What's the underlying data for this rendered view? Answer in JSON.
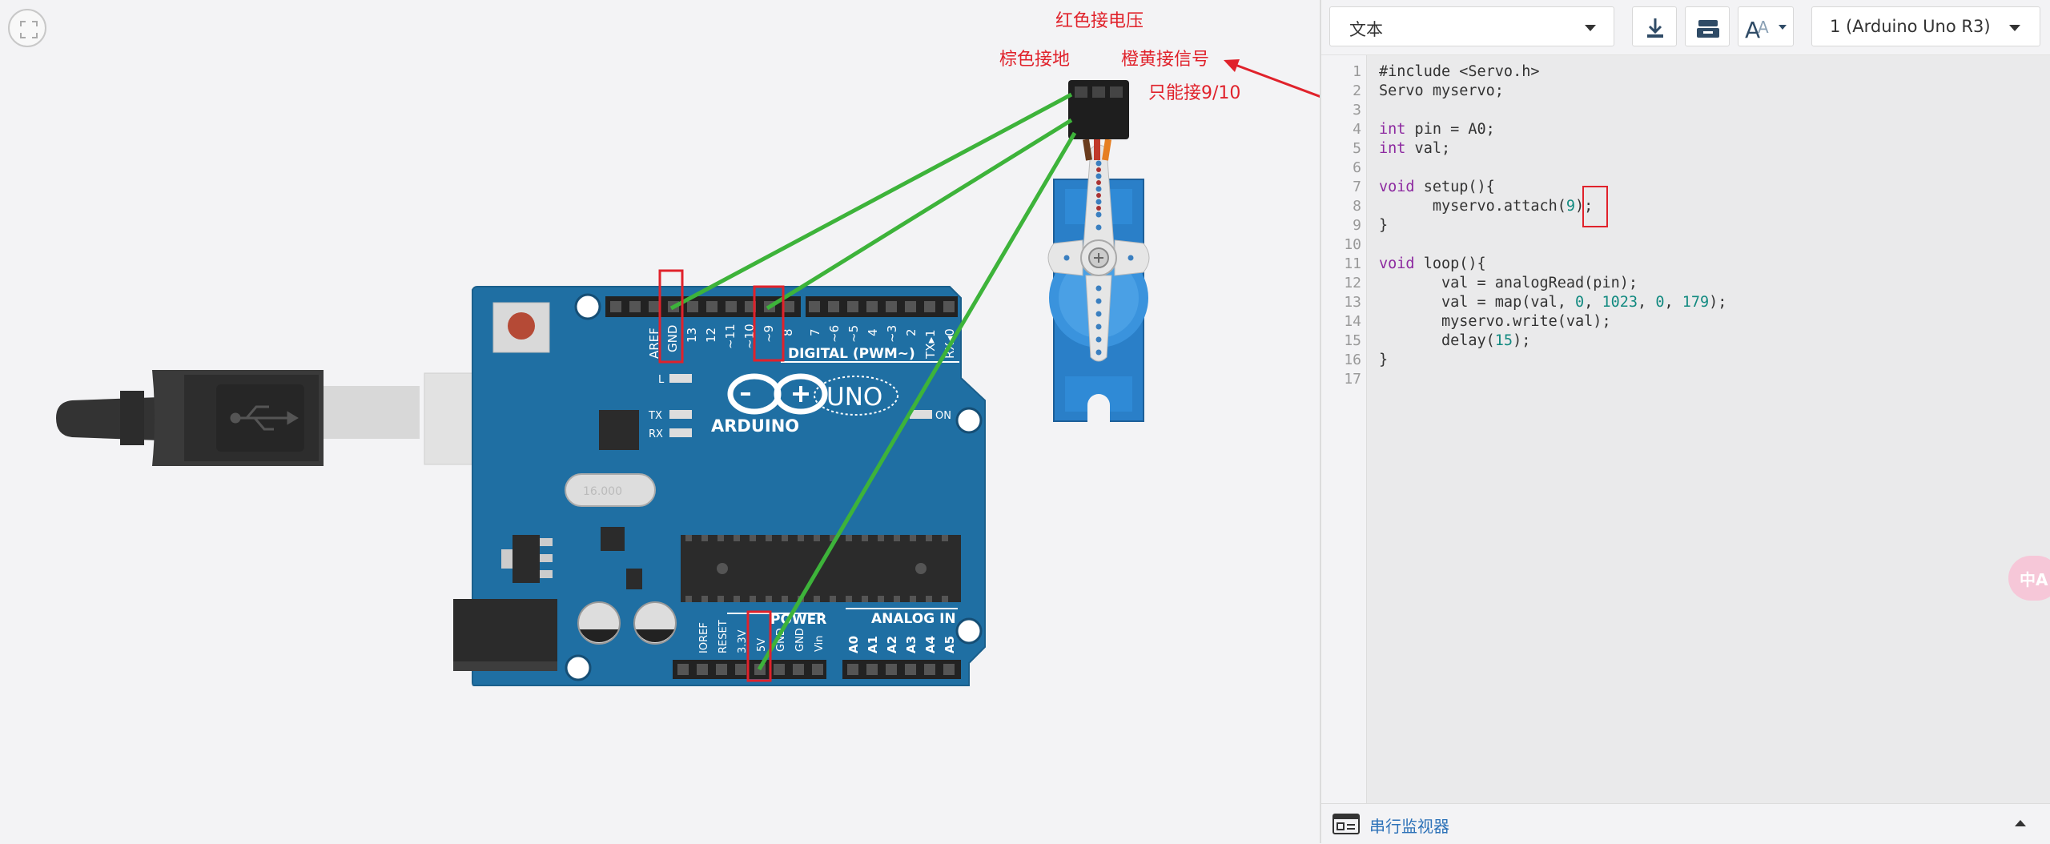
{
  "annotations": {
    "red_voltage": "红色接电压",
    "brown_ground": "棕色接地",
    "orange_signal": "橙黄接信号",
    "only_pins": "只能接9/10"
  },
  "board": {
    "brand": "ARDUINO",
    "model": "UNO",
    "digital_label": "DIGITAL (PWM~)",
    "power_label": "POWER",
    "analog_label": "ANALOG IN",
    "on_label": "ON",
    "led_labels": [
      "L",
      "TX",
      "RX"
    ],
    "top_pin_labels": [
      "AREF",
      "GND",
      "13",
      "12",
      "~11",
      "~10",
      "~9",
      "8",
      "7",
      "~6",
      "~5",
      "4",
      "~3",
      "2",
      "TX▸1",
      "RX◂0"
    ],
    "power_pin_labels": [
      "IOREF",
      "RESET",
      "3.3V",
      "5V",
      "GND",
      "GND",
      "Vin"
    ],
    "analog_pin_labels": [
      "A0",
      "A1",
      "A2",
      "A3",
      "A4",
      "A5"
    ],
    "crystal_label": "16.000"
  },
  "toolbar": {
    "mode_select": "文本",
    "device_select": "1 (Arduino Uno R3)",
    "icons": [
      "download-icon",
      "library-icon",
      "font-size-icon"
    ]
  },
  "code": {
    "line_numbers": [
      "1",
      "2",
      "3",
      "4",
      "5",
      "6",
      "7",
      "8",
      "9",
      "10",
      "11",
      "12",
      "13",
      "14",
      "15",
      "16",
      "17"
    ],
    "lines": [
      "#include <Servo.h>",
      "Servo myservo;",
      "",
      "int pin = A0;",
      "int val;",
      "",
      "void setup(){",
      "      myservo.attach(9);",
      "}",
      "",
      "void loop(){",
      "       val = analogRead(pin);",
      "       val = map(val, 0, 1023, 0, 179);",
      "       myservo.write(val);",
      "       delay(15);",
      "}",
      ""
    ]
  },
  "footer": {
    "serial_monitor": "串行监视器"
  },
  "colors": {
    "board_blue": "#1f6fa3",
    "wire_green": "#3db33a",
    "annotation_red": "#e0222b",
    "servo_blue": "#2a7fc8"
  }
}
